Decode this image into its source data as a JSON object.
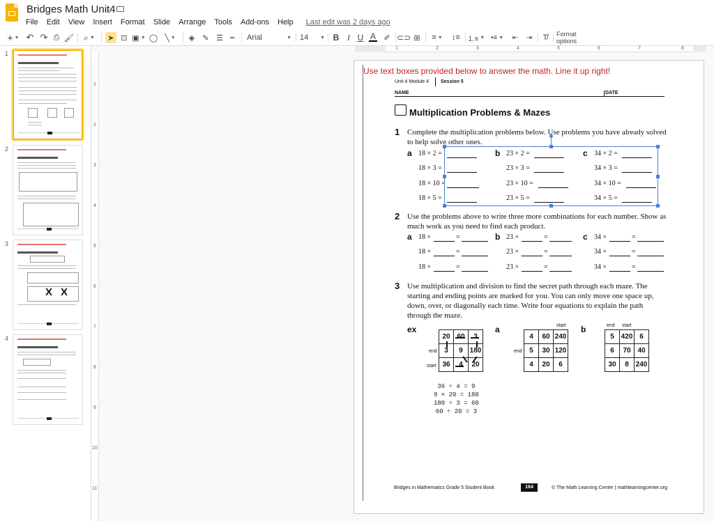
{
  "app": {
    "doc_title": "Bridges Math Unit4",
    "menus": [
      "File",
      "Edit",
      "View",
      "Insert",
      "Format",
      "Slide",
      "Arrange",
      "Tools",
      "Add-ons",
      "Help"
    ],
    "last_edit": "Last edit was 2 days ago",
    "brand_color": "#f4b400"
  },
  "toolbar": {
    "font_family": "Arial",
    "font_size": "14",
    "format_options": "Format options",
    "icons": [
      "add-icon",
      "undo-icon",
      "redo-icon",
      "print-icon",
      "paint-format-icon",
      "zoom-icon",
      "select-icon",
      "text-box-icon",
      "image-icon",
      "shape-icon",
      "line-icon",
      "fill-color-icon",
      "border-color-icon",
      "border-weight-icon",
      "border-dash-icon",
      "bold-icon",
      "italic-icon",
      "underline-icon",
      "text-color-icon",
      "highlight-icon",
      "link-icon",
      "comment-icon",
      "align-icon",
      "line-spacing-icon",
      "numbered-list-icon",
      "bulleted-list-icon",
      "decrease-indent-icon",
      "increase-indent-icon",
      "clear-formatting-icon"
    ]
  },
  "filmstrip": {
    "slides": [
      {
        "number": "1",
        "selected": true
      },
      {
        "number": "2",
        "selected": false
      },
      {
        "number": "3",
        "selected": false
      },
      {
        "number": "4",
        "selected": false
      }
    ]
  },
  "rulers": {
    "horizontal": [
      "1",
      "2",
      "3",
      "4",
      "5",
      "6",
      "7",
      "8"
    ],
    "vertical": [
      "1",
      "2",
      "3",
      "4",
      "5",
      "6",
      "7",
      "8",
      "9",
      "10",
      "11"
    ]
  },
  "slide": {
    "instruction": "Use text boxes provided below to answer the math. Line it up right!",
    "header": {
      "unit": "Unit 4  Module 4",
      "session": "Session 5",
      "name": "NAME",
      "date": "DATE"
    },
    "title": "Multiplication Problems & Mazes",
    "q1": {
      "number": "1",
      "text_line1": "Complete the multiplication problems below. Use problems you have already solved",
      "text_line2": "to help solve other ones.",
      "columns": [
        {
          "label": "a",
          "rows": [
            "18 × 2 =",
            "18 × 3 =",
            "18 × 10 =",
            "18 × 5 ="
          ]
        },
        {
          "label": "b",
          "rows": [
            "23 × 2 =",
            "23 × 3 =",
            "23 × 10 =",
            "23 × 5 ="
          ]
        },
        {
          "label": "c",
          "rows": [
            "34 × 2 =",
            "34 × 3 =",
            "34 × 10 =",
            "34 × 5 ="
          ]
        }
      ]
    },
    "q2": {
      "number": "2",
      "text_line1": "Use the problems above to write three more combinations for each number. Show as",
      "text_line2": "much work as you need to find each product.",
      "columns": [
        {
          "label": "a",
          "base": "18 ×"
        },
        {
          "label": "b",
          "base": "23 ×"
        },
        {
          "label": "c",
          "base": "34 ×"
        }
      ],
      "equals": "="
    },
    "q3": {
      "number": "3",
      "text_line1": "Use multiplication and division to find the secret path through each maze. The",
      "text_line2": "starting and ending points are marked for you. You can only move one space up,",
      "text_line3": "down, over, or diagonally each time. Write four equations to explain the path",
      "text_line4": "through the maze."
    },
    "mazes": {
      "ex": {
        "label": "ex",
        "cells": [
          [
            "20",
            "60",
            "3"
          ],
          [
            "3",
            "9",
            "180"
          ],
          [
            "36",
            "4",
            "20"
          ]
        ],
        "end": "end",
        "start": "start"
      },
      "a": {
        "label": "a",
        "cells": [
          [
            "4",
            "60",
            "240"
          ],
          [
            "5",
            "30",
            "120"
          ],
          [
            "4",
            "20",
            "6"
          ]
        ],
        "end": "end",
        "start": "start"
      },
      "c": {
        "label": "b",
        "cells": [
          [
            "5",
            "420",
            "6"
          ],
          [
            "6",
            "70",
            "40"
          ],
          [
            "30",
            "8",
            "240"
          ]
        ],
        "end": "end",
        "start": "start"
      }
    },
    "example_equations": [
      "36 ÷ 4 = 9",
      "9 × 20 = 180",
      "180 ÷ 3 = 60",
      "60 ÷ 20 = 3"
    ],
    "footer": {
      "left": "Bridges in Mathematics Grade 5 Student Book",
      "page": "164",
      "right": "© The Math Learning Center  |  mathlearningcenter.org"
    },
    "colors": {
      "instruction_red": "#c5221f",
      "selection_blue": "#4a7fd9"
    }
  }
}
